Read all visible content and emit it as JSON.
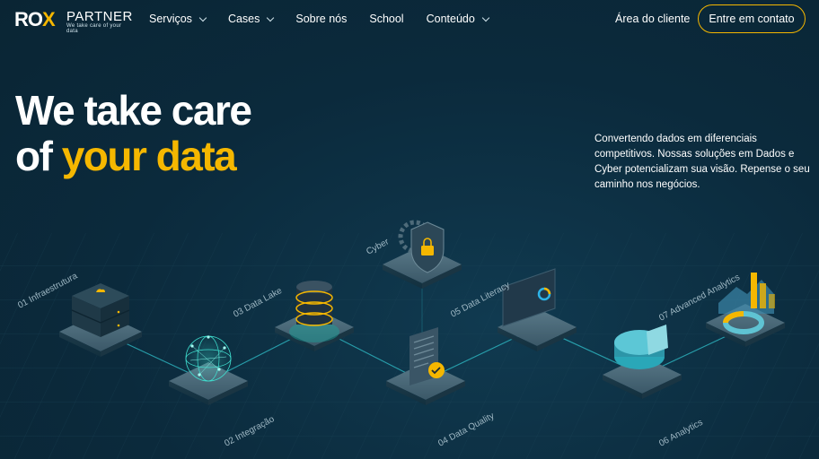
{
  "brand": {
    "mark_pre": "RO",
    "mark_x": "X",
    "word": "PARTNER",
    "tagline": "We take care of your data"
  },
  "nav": {
    "items": [
      {
        "label": "Serviços",
        "dropdown": true
      },
      {
        "label": "Cases",
        "dropdown": true
      },
      {
        "label": "Sobre nós",
        "dropdown": false
      },
      {
        "label": "School",
        "dropdown": false
      },
      {
        "label": "Conteúdo",
        "dropdown": true
      }
    ],
    "client_area": "Área do cliente",
    "contact_button": "Entre em contato"
  },
  "hero": {
    "line1": "We take care",
    "line2_pre": "of ",
    "line2_accent": "your data",
    "description": "Convertendo dados em diferenciais competitivos. Nossas soluções em Dados e Cyber potencializam sua visão. Repense o seu caminho nos negócios."
  },
  "steps": [
    {
      "label": "01 Infraestrutura",
      "icon": "server-icon"
    },
    {
      "label": "02 Integração",
      "icon": "globe-network-icon"
    },
    {
      "label": "03 Data Lake",
      "icon": "database-icon"
    },
    {
      "label": "Cyber",
      "icon": "shield-lock-icon"
    },
    {
      "label": "04 Data Quality",
      "icon": "document-check-icon"
    },
    {
      "label": "05 Data Literacy",
      "icon": "dashboard-icon"
    },
    {
      "label": "06 Analytics",
      "icon": "pie-chart-icon"
    },
    {
      "label": "07 Advanced Analytics",
      "icon": "bar-chart-icon"
    }
  ],
  "colors": {
    "background": "#0b2a3c",
    "accent": "#f5b700",
    "glow": "#3fe0d0"
  }
}
